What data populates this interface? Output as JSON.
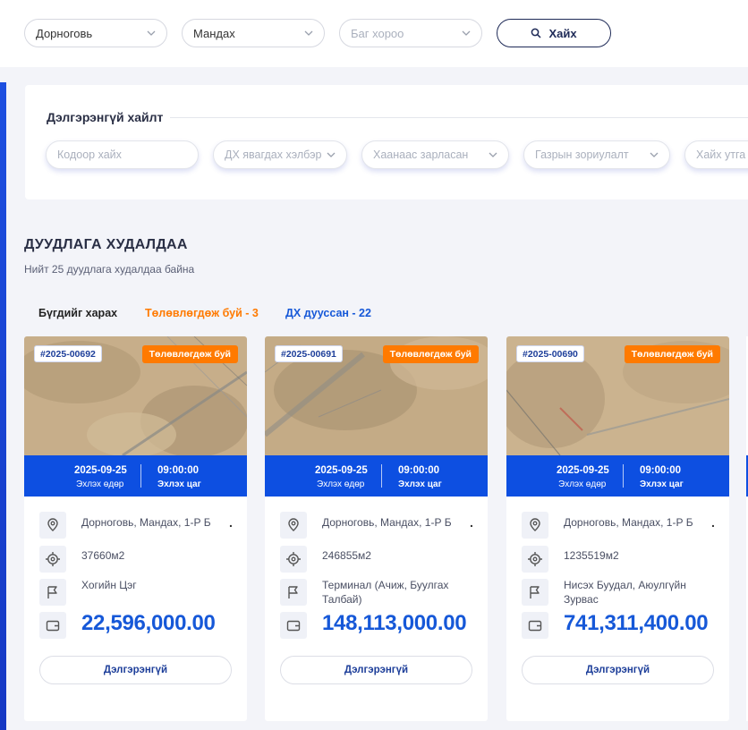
{
  "filters": {
    "aimag": "Дорноговь",
    "sum": "Мандах",
    "bag_placeholder": "Баг хороо",
    "search_label": "Хайх"
  },
  "advanced": {
    "title": "Дэлгэрэнгүй хайлт",
    "code_placeholder": "Кодоор хайх",
    "type_placeholder": "ДХ явагдах хэлбэр",
    "source_placeholder": "Хаанаас зарласан",
    "purpose_placeholder": "Газрын зориулалт",
    "value_placeholder": "Хайх утга"
  },
  "section": {
    "title": "ДУУДЛАГА ХУДАЛДАА",
    "subtitle": "Нийт 25 дуудлага худалдаа байна"
  },
  "tabs": [
    {
      "label": "Бүгдийг харах",
      "color": "#222222"
    },
    {
      "label": "Төлөвлөгдөж буй - 3",
      "color": "#ff7a00"
    },
    {
      "label": "ДХ дууссан - 22",
      "color": "#1658d8"
    }
  ],
  "cards": [
    {
      "code": "#2025-00692",
      "status": "Төлөвлөгдөж буй",
      "date": "2025-09-25",
      "date_label": "Эхлэх өдөр",
      "time": "09:00:00",
      "time_label": "Эхлэх цаг",
      "location": "Дорноговь, Мандах, 1-Р Б",
      "area": "37660м2",
      "name": "Хогийн Цэг",
      "price": "22,596,000.00",
      "more_label": "Дэлгэрэнгүй"
    },
    {
      "code": "#2025-00691",
      "status": "Төлөвлөгдөж буй",
      "date": "2025-09-25",
      "date_label": "Эхлэх өдөр",
      "time": "09:00:00",
      "time_label": "Эхлэх цаг",
      "location": "Дорноговь, Мандах, 1-Р Б",
      "area": "246855м2",
      "name": "Терминал (Ачиж, Буулгах Талбай)",
      "price": "148,113,000.00",
      "more_label": "Дэлгэрэнгүй"
    },
    {
      "code": "#2025-00690",
      "status": "Төлөвлөгдөж буй",
      "date": "2025-09-25",
      "date_label": "Эхлэх өдөр",
      "time": "09:00:00",
      "time_label": "Эхлэх цаг",
      "location": "Дорноговь, Мандах, 1-Р Б",
      "area": "1235519м2",
      "name": "Нисэх Буудал, Аюулгүйн Зурвас",
      "price": "741,311,400.00",
      "more_label": "Дэлгэрэнгүй"
    }
  ],
  "colors": {
    "primary": "#0d4fe1",
    "status_orange": "#ff7a00",
    "price_blue": "#1658d8"
  }
}
